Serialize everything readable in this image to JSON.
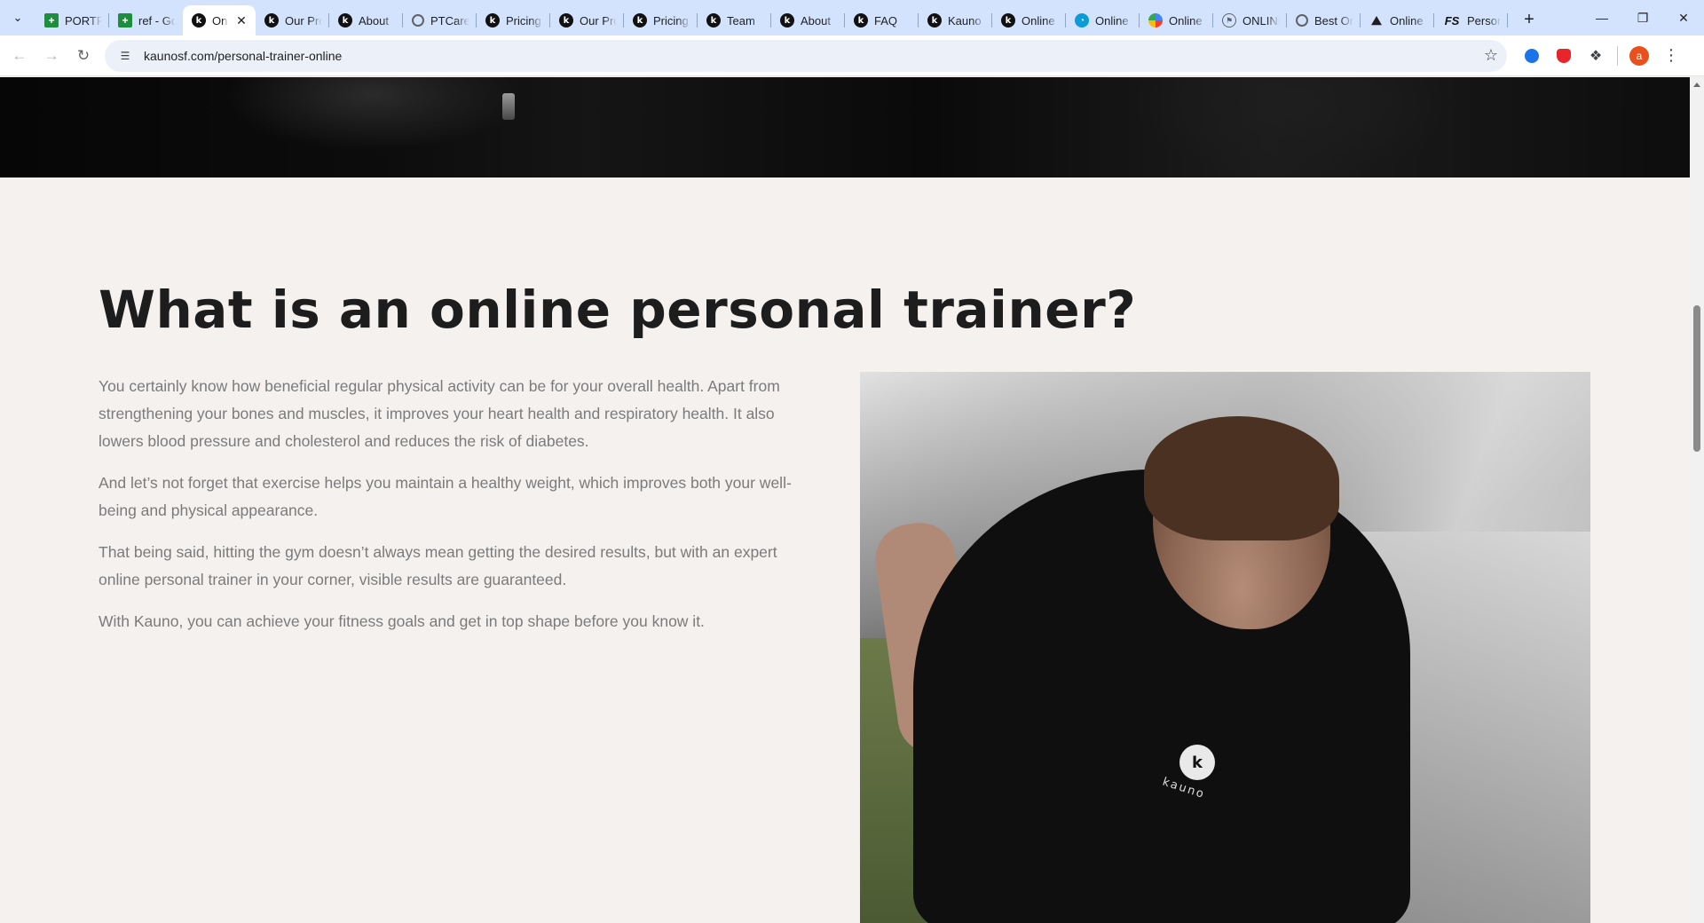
{
  "browser": {
    "tabs": [
      {
        "label": "PORTFOLIO",
        "favicon": "sheets-icon"
      },
      {
        "label": "ref - Google Sheets",
        "favicon": "sheets-icon"
      },
      {
        "label": "Online Personal Trainer",
        "favicon": "kauno-icon",
        "active": true
      },
      {
        "label": "Our Programs",
        "favicon": "kauno-icon"
      },
      {
        "label": "About",
        "favicon": "kauno-icon"
      },
      {
        "label": "PTCareers",
        "favicon": "globe-icon"
      },
      {
        "label": "Pricing",
        "favicon": "kauno-icon"
      },
      {
        "label": "Our Programs",
        "favicon": "kauno-icon"
      },
      {
        "label": "Pricing",
        "favicon": "kauno-icon"
      },
      {
        "label": "Team",
        "favicon": "kauno-icon"
      },
      {
        "label": "About",
        "favicon": "kauno-icon"
      },
      {
        "label": "FAQ",
        "favicon": "kauno-icon"
      },
      {
        "label": "Kauno",
        "favicon": "kauno-icon"
      },
      {
        "label": "Online",
        "favicon": "kauno-icon"
      },
      {
        "label": "Online",
        "favicon": "dial-icon"
      },
      {
        "label": "Online",
        "favicon": "colored-globe-icon"
      },
      {
        "label": "ONLINE",
        "favicon": "pin-icon"
      },
      {
        "label": "Best Online",
        "favicon": "globe-icon"
      },
      {
        "label": "Online",
        "favicon": "mountain-icon"
      },
      {
        "label": "Personal",
        "favicon": "fs-icon"
      }
    ],
    "address_url": "kaunosf.com/personal-trainer-online",
    "avatar_letter": "a"
  },
  "page": {
    "section_title": "What is an online personal trainer?",
    "paragraphs": [
      "You certainly know how beneficial regular physical activity can be for your overall health. Apart from strengthening your bones and muscles, it improves your heart health and respiratory health. It also lowers blood pressure and cholesterol and reduces the risk of diabetes.",
      "And let’s not forget that exercise helps you maintain a healthy weight, which improves both your well-being and physical appearance.",
      "That being said, hitting the gym doesn’t always mean getting the desired results, but with an expert online personal trainer in your corner, visible results are guaranteed.",
      "With Kauno, you can achieve your fitness goals and get in top shape before you know it."
    ],
    "photo_logo_letter": "k",
    "photo_logo_word": "kauno"
  },
  "colors": {
    "tabstrip": "#d3e3fd",
    "page_bg": "#f4f1ef",
    "title": "#1d1d1d",
    "body_text": "#7b7b7b"
  }
}
